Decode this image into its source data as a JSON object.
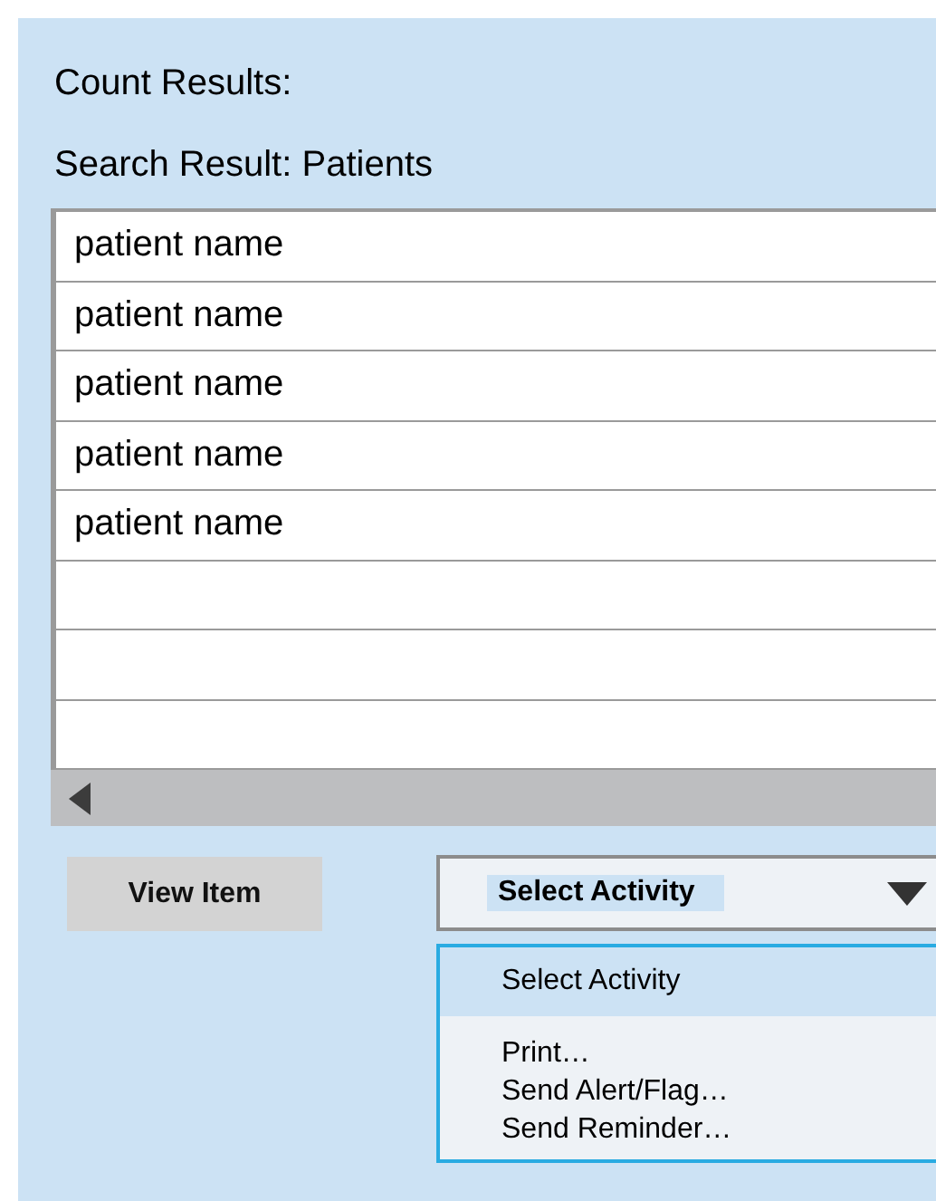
{
  "count_label": "Count Results:",
  "search_label": "Search Result: Patients",
  "results": [
    {
      "name": "patient name"
    },
    {
      "name": "patient name"
    },
    {
      "name": "patient name"
    },
    {
      "name": "patient name"
    },
    {
      "name": "patient name"
    }
  ],
  "view_button": "View Item",
  "activity_select": {
    "value": "Select Activity",
    "highlighted": true
  },
  "activity_options": [
    {
      "label": "Select Activity",
      "selected": true
    },
    {
      "label": "Print…",
      "selected": false
    },
    {
      "label": "Send Alert/Flag…",
      "selected": false
    },
    {
      "label": "Send Reminder…",
      "selected": false
    }
  ]
}
